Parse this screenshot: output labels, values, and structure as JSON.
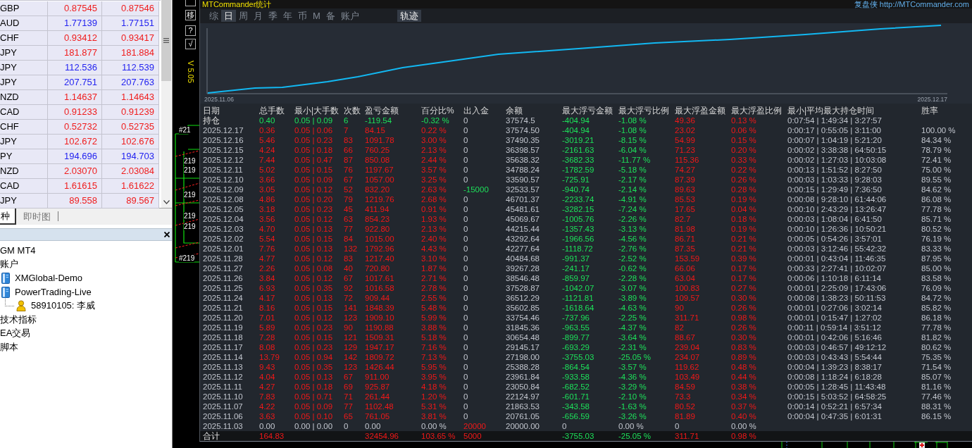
{
  "market_watch": {
    "rows": [
      {
        "symbol": "GBP",
        "bid": "0.87545",
        "ask": "0.87546",
        "color": "#f01c1c"
      },
      {
        "symbol": "AUD",
        "bid": "1.77139",
        "ask": "1.77151",
        "color": "#2323f0"
      },
      {
        "symbol": "CHF",
        "bid": "0.93412",
        "ask": "0.93417",
        "color": "#f01c1c"
      },
      {
        "symbol": "JPY",
        "bid": "181.877",
        "ask": "181.884",
        "color": "#f01c1c"
      },
      {
        "symbol": "JPY",
        "bid": "112.536",
        "ask": "112.539",
        "color": "#2323f0"
      },
      {
        "symbol": "JPY",
        "bid": "207.751",
        "ask": "207.763",
        "color": "#2323f0"
      },
      {
        "symbol": "NZD",
        "bid": "1.14637",
        "ask": "1.14643",
        "color": "#f01c1c"
      },
      {
        "symbol": "CAD",
        "bid": "0.91233",
        "ask": "0.91239",
        "color": "#f01c1c"
      },
      {
        "symbol": "CHF",
        "bid": "0.52732",
        "ask": "0.52735",
        "color": "#f01c1c"
      },
      {
        "symbol": "JPY",
        "bid": "102.672",
        "ask": "102.676",
        "color": "#f01c1c"
      },
      {
        "symbol": "PY",
        "bid": "194.696",
        "ask": "194.703",
        "color": "#2323f0"
      },
      {
        "symbol": "NZD",
        "bid": "2.03070",
        "ask": "2.03084",
        "color": "#f01c1c"
      },
      {
        "symbol": "CAD",
        "bid": "1.61615",
        "ask": "1.61622",
        "color": "#f01c1c"
      },
      {
        "symbol": "JPY",
        "bid": "89.558",
        "ask": "89.567",
        "color": "#f01c1c"
      }
    ]
  },
  "left_tabs": [
    {
      "label": "种",
      "selected": true
    },
    {
      "label": "即时图",
      "selected": false
    }
  ],
  "navigator": {
    "tree": [
      {
        "label": "GM MT4"
      },
      {
        "label": "账户",
        "children": [
          {
            "label": "XMGlobal-Demo",
            "kind": "server"
          },
          {
            "label": "PowerTrading-Live",
            "kind": "server",
            "children": [
              {
                "label": "58910105: 李威",
                "kind": "account"
              }
            ]
          }
        ]
      },
      {
        "label": "技术指标"
      },
      {
        "label": "EA交易"
      },
      {
        "label": "脚本"
      }
    ]
  },
  "chart_labels": [
    "#21",
    "219",
    "219",
    "219",
    "219",
    "219",
    "#219"
  ],
  "side_buttons": [
    {
      "kind": "blank"
    },
    {
      "kind": "move",
      "label": "移"
    },
    {
      "kind": "help",
      "label": "?"
    },
    {
      "kind": "confirm",
      "label": "√"
    }
  ],
  "version": "V 5.05",
  "stats": {
    "title": "MTCommander统计",
    "brand": "复盘侠",
    "link": "http://MTCommander.com",
    "tabs": [
      {
        "label": "综",
        "selected": false
      },
      {
        "label": "日",
        "selected": true
      },
      {
        "label": "周",
        "selected": false
      },
      {
        "label": "月",
        "selected": false
      },
      {
        "label": "季",
        "selected": false
      },
      {
        "label": "年",
        "selected": false
      },
      {
        "label": "币",
        "selected": false
      },
      {
        "label": "M",
        "selected": false
      },
      {
        "label": "备",
        "selected": false
      },
      {
        "label": "账户",
        "selected": false
      }
    ],
    "trace_toggle": {
      "label": "轨迹",
      "on": true
    },
    "chart": {
      "start_label": "2025.11.06",
      "end_label": "2025.12.17"
    },
    "table": {
      "columns": [
        "日期",
        "总手数",
        "最小|大手数",
        "次数",
        "盈亏金额",
        "百分比%",
        "出入金",
        "余额",
        "最大浮亏金额",
        "最大浮亏比例",
        "最大浮盈金额",
        "最大浮盈比例",
        "最小|平均最大持仓时间",
        "胜率"
      ],
      "open_row": {
        "label": "持仓",
        "kind": "loss",
        "lots": "0.40",
        "lot_range": "0.05 | 0.09",
        "trades": "6",
        "pnl": "-119.54",
        "percent": "-0.32 %",
        "flow": {
          "text": "0",
          "kind": "none"
        },
        "balance": "37574.5",
        "max_float_loss": "-404.94",
        "max_float_loss_pct": "-1.08 %",
        "max_float_profit": "49.36",
        "max_float_profit_pct": "0.13 %",
        "hold_times": "0:07:54 | 1:49:34 | 3:27:57"
      },
      "rows": [
        {
          "date": "2025.12.17",
          "kind": "profit",
          "lots": "0.36",
          "lot_range": "0.05 | 0.06",
          "trades": "7",
          "pnl": "84.15",
          "percent": "0.22 %",
          "flow": {
            "text": "0",
            "kind": "none"
          },
          "balance": "37574.50",
          "max_float_loss": "-404.94",
          "max_float_loss_pct": "-1.08 %",
          "max_float_profit": "23.02",
          "max_float_profit_pct": "0.06 %",
          "hold_times": "0:00:17 | 0:55:05 | 3:11:00",
          "win_rate": "100.00 %"
        },
        {
          "date": "2025.12.16",
          "kind": "profit",
          "lots": "5.46",
          "lot_range": "0.05 | 0.23",
          "trades": "83",
          "pnl": "1091.78",
          "percent": "3.00 %",
          "flow": {
            "text": "0",
            "kind": "none"
          },
          "balance": "37490.35",
          "max_float_loss": "-3019.21",
          "max_float_loss_pct": "-8.15 %",
          "max_float_profit": "54.99",
          "max_float_profit_pct": "0.15 %",
          "hold_times": "0:00:07 | 1:04:19 | 5:21:20",
          "win_rate": "84.34 %"
        },
        {
          "date": "2025.12.15",
          "kind": "profit",
          "lots": "4.24",
          "lot_range": "0.05 | 0.18",
          "trades": "66",
          "pnl": "760.25",
          "percent": "2.13 %",
          "flow": {
            "text": "0",
            "kind": "none"
          },
          "balance": "36398.57",
          "max_float_loss": "-2161.63",
          "max_float_loss_pct": "-6.04 %",
          "max_float_profit": "71.23",
          "max_float_profit_pct": "0.20 %",
          "hold_times": "0:00:02 | 3:38:38 | 64:50:15",
          "win_rate": "78.79 %"
        },
        {
          "date": "2025.12.12",
          "kind": "profit",
          "lots": "7.44",
          "lot_range": "0.05 | 0.47",
          "trades": "87",
          "pnl": "850.08",
          "percent": "2.44 %",
          "flow": {
            "text": "0",
            "kind": "none"
          },
          "balance": "35638.32",
          "max_float_loss": "-3682.33",
          "max_float_loss_pct": "-11.77 %",
          "max_float_profit": "115.36",
          "max_float_profit_pct": "0.33 %",
          "hold_times": "0:00:02 | 1:27:03 | 10:03:08",
          "win_rate": "72.41 %"
        },
        {
          "date": "2025.12.11",
          "kind": "profit",
          "lots": "5.02",
          "lot_range": "0.05 | 0.15",
          "trades": "76",
          "pnl": "1197.67",
          "percent": "3.57 %",
          "flow": {
            "text": "0",
            "kind": "none"
          },
          "balance": "34788.24",
          "max_float_loss": "-1782.59",
          "max_float_loss_pct": "-5.18 %",
          "max_float_profit": "74.27",
          "max_float_profit_pct": "0.22 %",
          "hold_times": "0:00:13 | 1:51:52 | 8:27:50",
          "win_rate": "75.00 %"
        },
        {
          "date": "2025.12.10",
          "kind": "profit",
          "lots": "3.66",
          "lot_range": "0.05 | 0.09",
          "trades": "67",
          "pnl": "1057.00",
          "percent": "3.25 %",
          "flow": {
            "text": "0",
            "kind": "none"
          },
          "balance": "33590.57",
          "max_float_loss": "-725.91",
          "max_float_loss_pct": "-2.17 %",
          "max_float_profit": "87.39",
          "max_float_profit_pct": "0.26 %",
          "hold_times": "0:00:03 | 1:03:33 | 9:28:03",
          "win_rate": "89.55 %"
        },
        {
          "date": "2025.12.09",
          "kind": "profit",
          "lots": "3.05",
          "lot_range": "0.05 | 0.12",
          "trades": "52",
          "pnl": "832.20",
          "percent": "2.63 %",
          "flow": {
            "text": "-15000",
            "kind": "withdrawal"
          },
          "balance": "32533.57",
          "max_float_loss": "-940.74",
          "max_float_loss_pct": "-2.14 %",
          "max_float_profit": "89.63",
          "max_float_profit_pct": "0.28 %",
          "hold_times": "0:00:15 | 1:29:49 | 7:36:50",
          "win_rate": "84.62 %"
        },
        {
          "date": "2025.12.08",
          "kind": "profit",
          "lots": "4.86",
          "lot_range": "0.05 | 0.20",
          "trades": "79",
          "pnl": "1219.76",
          "percent": "2.68 %",
          "flow": {
            "text": "0",
            "kind": "none"
          },
          "balance": "46701.37",
          "max_float_loss": "-2233.74",
          "max_float_loss_pct": "-4.91 %",
          "max_float_profit": "85.53",
          "max_float_profit_pct": "0.19 %",
          "hold_times": "0:00:08 | 9:28:10 | 61:44:06",
          "win_rate": "86.08 %"
        },
        {
          "date": "2025.12.05",
          "kind": "profit",
          "lots": "3.18",
          "lot_range": "0.05 | 0.23",
          "trades": "45",
          "pnl": "411.94",
          "percent": "0.91 %",
          "flow": {
            "text": "0",
            "kind": "none"
          },
          "balance": "45481.61",
          "max_float_loss": "-3282.15",
          "max_float_loss_pct": "-7.24 %",
          "max_float_profit": "17.65",
          "max_float_profit_pct": "0.04 %",
          "hold_times": "0:00:10 | 2:43:29 | 13:26:47",
          "win_rate": "77.78 %"
        },
        {
          "date": "2025.12.04",
          "kind": "profit",
          "lots": "3.56",
          "lot_range": "0.05 | 0.12",
          "trades": "63",
          "pnl": "854.23",
          "percent": "1.93 %",
          "flow": {
            "text": "0",
            "kind": "none"
          },
          "balance": "45069.67",
          "max_float_loss": "-1005.76",
          "max_float_loss_pct": "-2.26 %",
          "max_float_profit": "82.7",
          "max_float_profit_pct": "0.18 %",
          "hold_times": "0:00:03 | 1:08:04 | 6:41:50",
          "win_rate": "85.71 %"
        },
        {
          "date": "2025.12.03",
          "kind": "profit",
          "lots": "4.70",
          "lot_range": "0.05 | 0.13",
          "trades": "77",
          "pnl": "922.80",
          "percent": "2.13 %",
          "flow": {
            "text": "0",
            "kind": "none"
          },
          "balance": "44215.44",
          "max_float_loss": "-1357.43",
          "max_float_loss_pct": "-3.13 %",
          "max_float_profit": "81.98",
          "max_float_profit_pct": "0.19 %",
          "hold_times": "0:00:10 | 1:26:36 | 10:50:21",
          "win_rate": "80.52 %"
        },
        {
          "date": "2025.12.02",
          "kind": "profit",
          "lots": "5.54",
          "lot_range": "0.05 | 0.15",
          "trades": "84",
          "pnl": "1015.00",
          "percent": "2.40 %",
          "flow": {
            "text": "0",
            "kind": "none"
          },
          "balance": "43292.64",
          "max_float_loss": "-1966.56",
          "max_float_loss_pct": "-4.56 %",
          "max_float_profit": "86.71",
          "max_float_profit_pct": "0.21 %",
          "hold_times": "0:00:05 | 0:54:26 | 3:57:01",
          "win_rate": "76.19 %"
        },
        {
          "date": "2025.12.01",
          "kind": "profit",
          "lots": "7.76",
          "lot_range": "0.05 | 0.13",
          "trades": "132",
          "pnl": "1792.96",
          "percent": "4.43 %",
          "flow": {
            "text": "0",
            "kind": "none"
          },
          "balance": "42277.64",
          "max_float_loss": "-1118.72",
          "max_float_loss_pct": "-2.76 %",
          "max_float_profit": "87.35",
          "max_float_profit_pct": "0.21 %",
          "hold_times": "0:00:03 | 3:12:46 | 55:42:32",
          "win_rate": "83.33 %"
        },
        {
          "date": "2025.11.28",
          "kind": "profit",
          "lots": "4.77",
          "lot_range": "0.05 | 0.12",
          "trades": "83",
          "pnl": "1217.40",
          "percent": "3.10 %",
          "flow": {
            "text": "0",
            "kind": "none"
          },
          "balance": "40484.68",
          "max_float_loss": "-991.37",
          "max_float_loss_pct": "-2.52 %",
          "max_float_profit": "153.59",
          "max_float_profit_pct": "0.39 %",
          "hold_times": "0:00:01 | 0:43:04 | 11:46:35",
          "win_rate": "87.95 %"
        },
        {
          "date": "2025.11.27",
          "kind": "profit",
          "lots": "2.26",
          "lot_range": "0.05 | 0.08",
          "trades": "40",
          "pnl": "720.80",
          "percent": "1.87 %",
          "flow": {
            "text": "0",
            "kind": "none"
          },
          "balance": "39267.28",
          "max_float_loss": "-241.17",
          "max_float_loss_pct": "-0.62 %",
          "max_float_profit": "66.06",
          "max_float_profit_pct": "0.17 %",
          "hold_times": "0:00:33 | 2:27:41 | 10:02:07",
          "win_rate": "85.00 %"
        },
        {
          "date": "2025.11.26",
          "kind": "profit",
          "lots": "3.84",
          "lot_range": "0.05 | 0.12",
          "trades": "67",
          "pnl": "1017.61",
          "percent": "2.71 %",
          "flow": {
            "text": "0",
            "kind": "none"
          },
          "balance": "38546.48",
          "max_float_loss": "-859.97",
          "max_float_loss_pct": "-2.28 %",
          "max_float_profit": "63.04",
          "max_float_profit_pct": "0.17 %",
          "hold_times": "0:00:06 | 1:10:18 | 6:11:14",
          "win_rate": "83.58 %"
        },
        {
          "date": "2025.11.25",
          "kind": "profit",
          "lots": "6.93",
          "lot_range": "0.05 | 0.35",
          "trades": "92",
          "pnl": "1016.58",
          "percent": "2.78 %",
          "flow": {
            "text": "0",
            "kind": "none"
          },
          "balance": "37528.87",
          "max_float_loss": "-1042.07",
          "max_float_loss_pct": "-3.07 %",
          "max_float_profit": "100.83",
          "max_float_profit_pct": "0.27 %",
          "hold_times": "0:00:01 | 2:25:09 | 17:43:06",
          "win_rate": "76.09 %"
        },
        {
          "date": "2025.11.24",
          "kind": "profit",
          "lots": "4.17",
          "lot_range": "0.05 | 0.13",
          "trades": "72",
          "pnl": "909.44",
          "percent": "2.55 %",
          "flow": {
            "text": "0",
            "kind": "none"
          },
          "balance": "36512.29",
          "max_float_loss": "-1121.81",
          "max_float_loss_pct": "-3.89 %",
          "max_float_profit": "109.57",
          "max_float_profit_pct": "0.30 %",
          "hold_times": "0:00:08 | 1:38:23 | 50:11:53",
          "win_rate": "84.72 %"
        },
        {
          "date": "2025.11.21",
          "kind": "profit",
          "lots": "8.16",
          "lot_range": "0.05 | 0.15",
          "trades": "141",
          "pnl": "1848.39",
          "percent": "5.48 %",
          "flow": {
            "text": "0",
            "kind": "none"
          },
          "balance": "35602.85",
          "max_float_loss": "-1618.64",
          "max_float_loss_pct": "-4.63 %",
          "max_float_profit": "90",
          "max_float_profit_pct": "0.26 %",
          "hold_times": "0:00:01 | 0:27:06 | 3:02:14",
          "win_rate": "85.82 %"
        },
        {
          "date": "2025.11.20",
          "kind": "profit",
          "lots": "7.01",
          "lot_range": "0.05 | 0.12",
          "trades": "123",
          "pnl": "1909.10",
          "percent": "5.99 %",
          "flow": {
            "text": "0",
            "kind": "none"
          },
          "balance": "33754.46",
          "max_float_loss": "-737.96",
          "max_float_loss_pct": "-2.25 %",
          "max_float_profit": "311.71",
          "max_float_profit_pct": "0.98 %",
          "hold_times": "0:00:01 | 0:15:47 | 1:27:02",
          "win_rate": "86.18 %"
        },
        {
          "date": "2025.11.19",
          "kind": "profit",
          "lots": "5.89",
          "lot_range": "0.05 | 0.23",
          "trades": "90",
          "pnl": "1190.88",
          "percent": "3.88 %",
          "flow": {
            "text": "0",
            "kind": "none"
          },
          "balance": "31845.36",
          "max_float_loss": "-963.55",
          "max_float_loss_pct": "-4.37 %",
          "max_float_profit": "82",
          "max_float_profit_pct": "0.26 %",
          "hold_times": "0:00:11 | 0:59:14 | 3:51:12",
          "win_rate": "77.78 %"
        },
        {
          "date": "2025.11.18",
          "kind": "profit",
          "lots": "7.28",
          "lot_range": "0.05 | 0.15",
          "trades": "121",
          "pnl": "1509.31",
          "percent": "5.18 %",
          "flow": {
            "text": "0",
            "kind": "none"
          },
          "balance": "30654.48",
          "max_float_loss": "-899.77",
          "max_float_loss_pct": "-3.64 %",
          "max_float_profit": "88.67",
          "max_float_profit_pct": "0.30 %",
          "hold_times": "0:00:01 | 0:42:06 | 5:16:46",
          "win_rate": "81.82 %"
        },
        {
          "date": "2025.11.17",
          "kind": "profit",
          "lots": "8.08",
          "lot_range": "0.05 | 0.23",
          "trades": "129",
          "pnl": "1947.17",
          "percent": "7.16 %",
          "flow": {
            "text": "0",
            "kind": "none"
          },
          "balance": "29145.17",
          "max_float_loss": "-693.29",
          "max_float_loss_pct": "-2.31 %",
          "max_float_profit": "239.04",
          "max_float_profit_pct": "0.83 %",
          "hold_times": "0:00:03 | 0:46:57 | 49:12:12",
          "win_rate": "80.62 %"
        },
        {
          "date": "2025.11.14",
          "kind": "profit",
          "lots": "13.79",
          "lot_range": "0.05 | 0.94",
          "trades": "142",
          "pnl": "1809.72",
          "percent": "7.13 %",
          "flow": {
            "text": "0",
            "kind": "none"
          },
          "balance": "27198.00",
          "max_float_loss": "-3755.03",
          "max_float_loss_pct": "-25.05 %",
          "max_float_profit": "234.07",
          "max_float_profit_pct": "0.89 %",
          "hold_times": "0:00:03 | 0:43:43 | 5:54:44",
          "win_rate": "75.35 %"
        },
        {
          "date": "2025.11.13",
          "kind": "profit",
          "lots": "9.43",
          "lot_range": "0.05 | 0.35",
          "trades": "123",
          "pnl": "1426.44",
          "percent": "5.95 %",
          "flow": {
            "text": "0",
            "kind": "none"
          },
          "balance": "25388.28",
          "max_float_loss": "-864.54",
          "max_float_loss_pct": "-3.57 %",
          "max_float_profit": "119.62",
          "max_float_profit_pct": "0.48 %",
          "hold_times": "0:00:04 | 1:39:23 | 8:38:17",
          "win_rate": "71.54 %"
        },
        {
          "date": "2025.11.12",
          "kind": "profit",
          "lots": "4.04",
          "lot_range": "0.05 | 0.13",
          "trades": "67",
          "pnl": "911.00",
          "percent": "3.95 %",
          "flow": {
            "text": "0",
            "kind": "none"
          },
          "balance": "23961.84",
          "max_float_loss": "-933.58",
          "max_float_loss_pct": "-4.36 %",
          "max_float_profit": "103.49",
          "max_float_profit_pct": "0.44 %",
          "hold_times": "0:00:08 | 1:18:24 | 6:18:28",
          "win_rate": "85.07 %"
        },
        {
          "date": "2025.11.11",
          "kind": "profit",
          "lots": "4.27",
          "lot_range": "0.05 | 0.18",
          "trades": "69",
          "pnl": "925.87",
          "percent": "4.18 %",
          "flow": {
            "text": "0",
            "kind": "none"
          },
          "balance": "23050.84",
          "max_float_loss": "-682.52",
          "max_float_loss_pct": "-3.29 %",
          "max_float_profit": "84.59",
          "max_float_profit_pct": "0.38 %",
          "hold_times": "0:00:05 | 1:28:45 | 11:43:48",
          "win_rate": "81.16 %"
        },
        {
          "date": "2025.11.10",
          "kind": "profit",
          "lots": "7.83",
          "lot_range": "0.05 | 0.71",
          "trades": "71",
          "pnl": "261.44",
          "percent": "1.20 %",
          "flow": {
            "text": "0",
            "kind": "none"
          },
          "balance": "22124.97",
          "max_float_loss": "-601.71",
          "max_float_loss_pct": "-2.10 %",
          "max_float_profit": "73.3",
          "max_float_profit_pct": "0.34 %",
          "hold_times": "0:00:15 | 5:03:52 | 64:58:25",
          "win_rate": "77.46 %"
        },
        {
          "date": "2025.11.07",
          "kind": "profit",
          "lots": "4.22",
          "lot_range": "0.05 | 0.09",
          "trades": "77",
          "pnl": "1102.48",
          "percent": "5.31 %",
          "flow": {
            "text": "0",
            "kind": "none"
          },
          "balance": "21863.53",
          "max_float_loss": "-343.58",
          "max_float_loss_pct": "-1.63 %",
          "max_float_profit": "80.52",
          "max_float_profit_pct": "0.37 %",
          "hold_times": "0:00:14 | 0:52:21 | 6:57:34",
          "win_rate": "88.31 %"
        },
        {
          "date": "2025.11.06",
          "kind": "profit",
          "lots": "3.63",
          "lot_range": "0.05 | 0.10",
          "trades": "65",
          "pnl": "761.05",
          "percent": "3.81 %",
          "flow": {
            "text": "0",
            "kind": "none"
          },
          "balance": "20761.05",
          "max_float_loss": "-656.59",
          "max_float_loss_pct": "-3.26 %",
          "max_float_profit": "81.89",
          "max_float_profit_pct": "0.40 %",
          "hold_times": "0:00:04 | 0:47:35 | 6:01:31",
          "win_rate": "86.15 %"
        },
        {
          "date": "2025.11.03",
          "kind": "flat",
          "lots": "0.00",
          "lot_range": "0.00 | 0.00",
          "trades": "0",
          "pnl": "0.00",
          "percent": "0.00 %",
          "flow": {
            "text": "20000",
            "kind": "deposit"
          },
          "balance": "20000.00",
          "max_float_loss": "0",
          "max_float_loss_pct": "0.00 %",
          "max_float_profit": "0",
          "max_float_profit_pct": "0.00 %"
        }
      ],
      "total_row": {
        "label": "合计",
        "kind": "profit",
        "lots": "164.83",
        "pnl": "32454.96",
        "percent": "103.65 %",
        "flow": {
          "text": "5000",
          "kind": "deposit"
        },
        "max_float_loss": "-3755.03",
        "max_float_loss_pct": "-25.05 %",
        "max_float_profit": "311.71",
        "max_float_profit_pct": "0.98 %"
      }
    }
  }
}
